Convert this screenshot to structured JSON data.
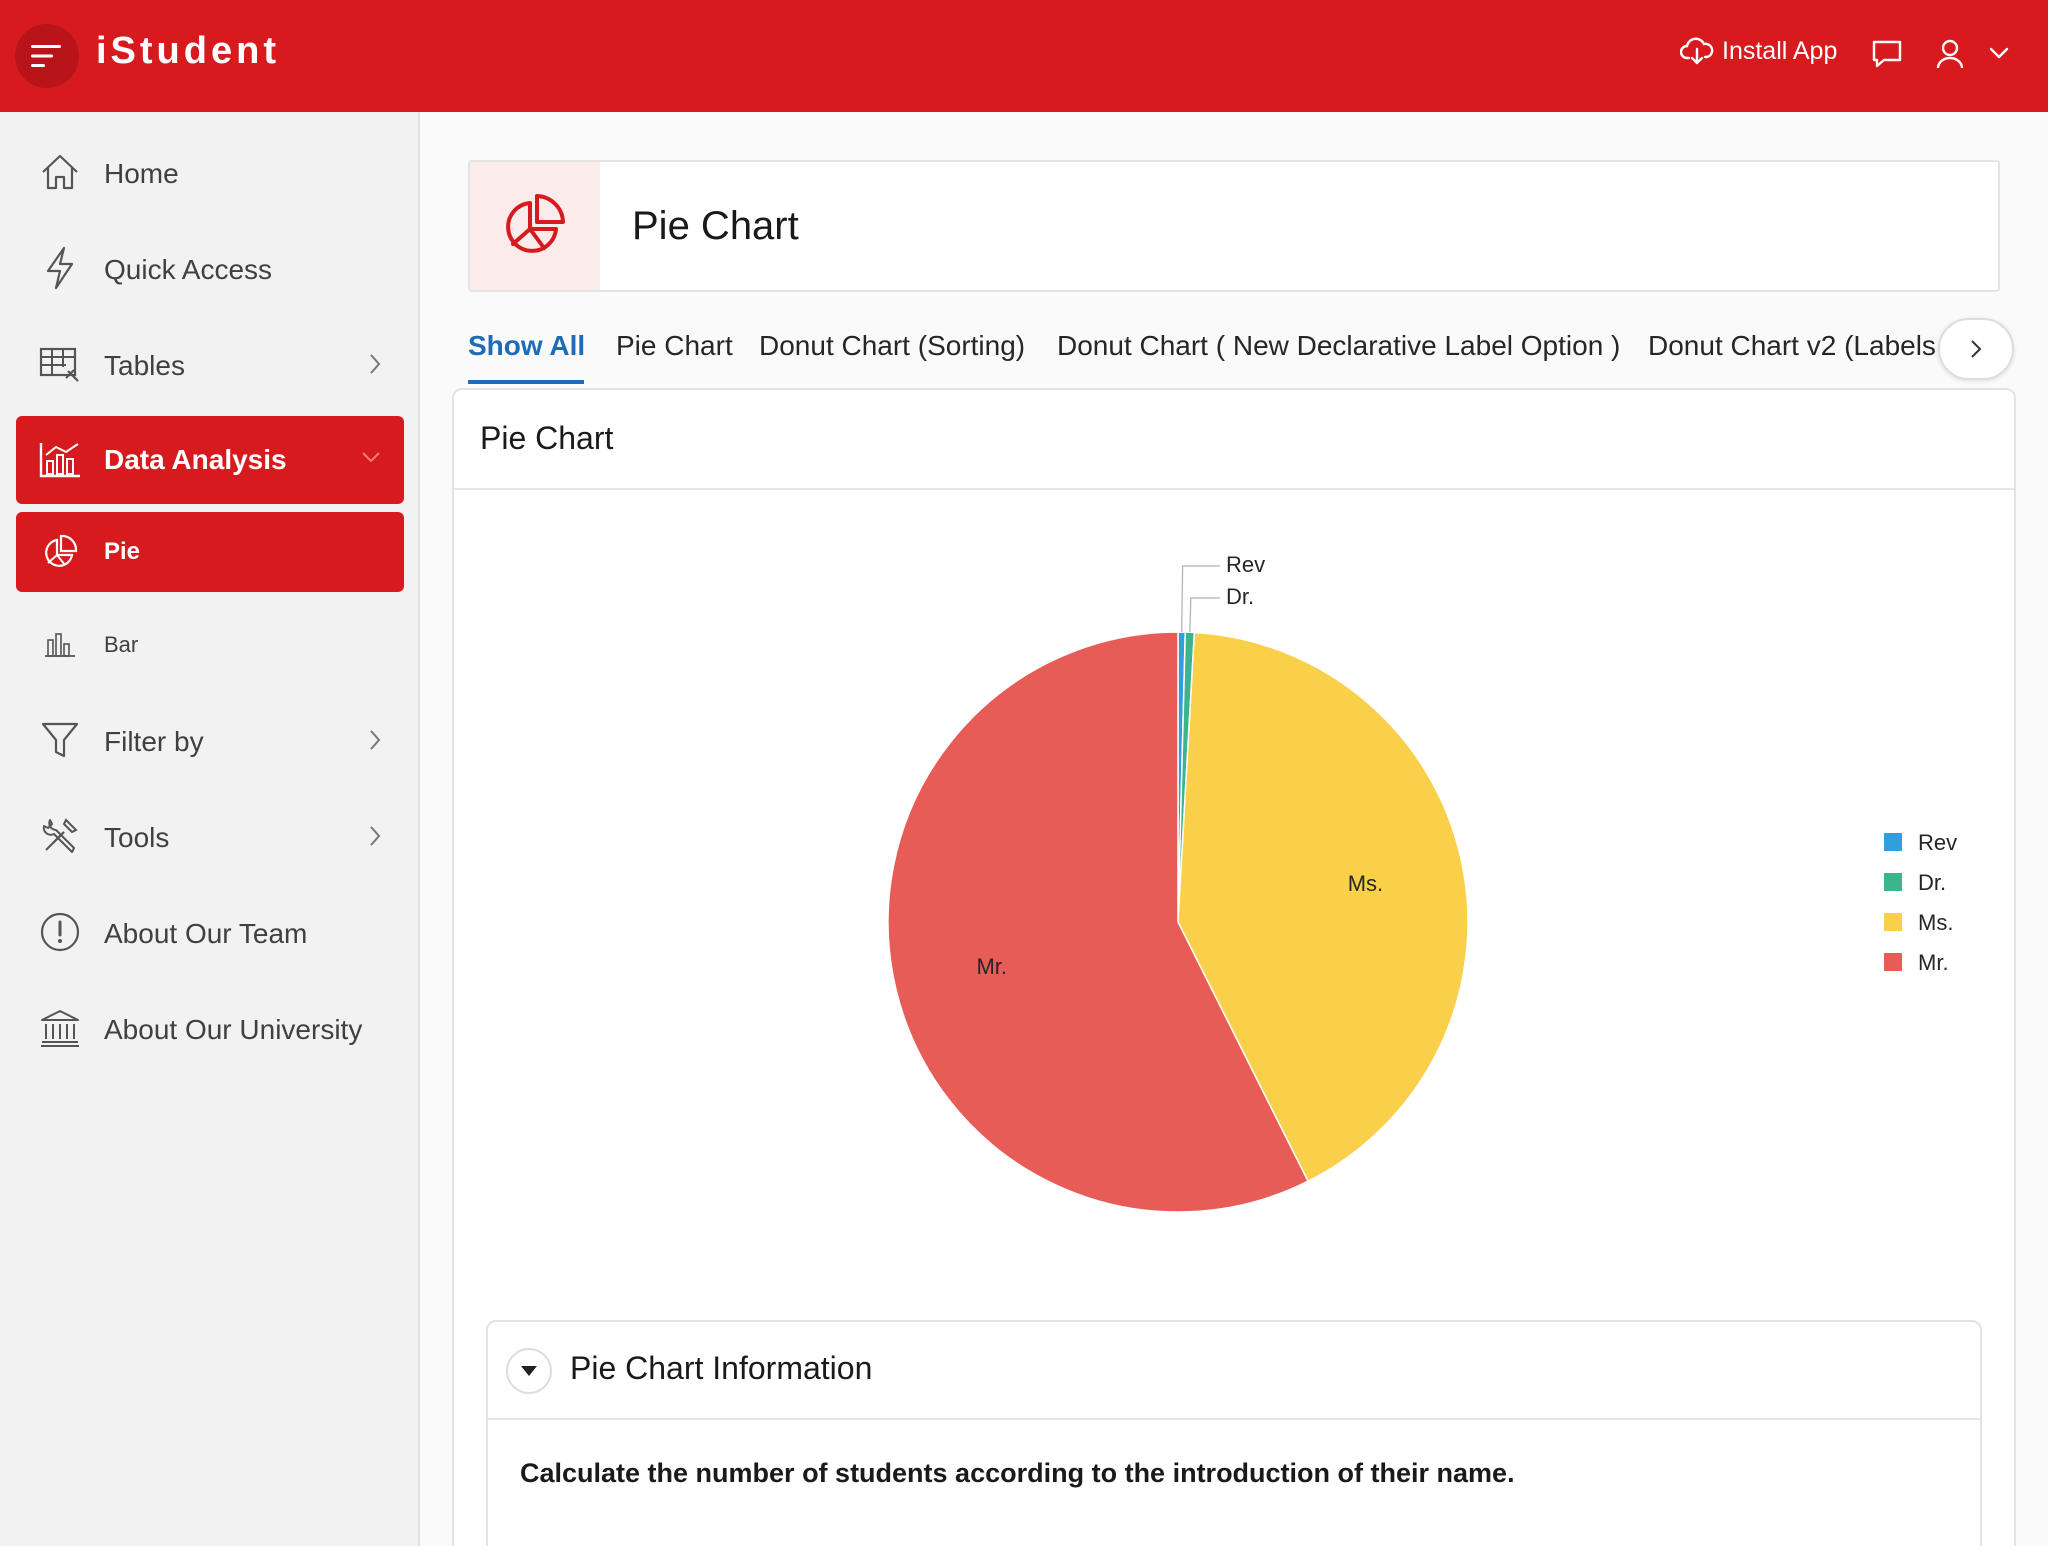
{
  "app": {
    "title": "iStudent"
  },
  "header": {
    "install_label": "Install App"
  },
  "sidebar": {
    "items": [
      {
        "label": "Home"
      },
      {
        "label": "Quick Access"
      },
      {
        "label": "Tables"
      },
      {
        "label": "Data Analysis"
      },
      {
        "label": "Pie"
      },
      {
        "label": "Bar"
      },
      {
        "label": "Filter by"
      },
      {
        "label": "Tools"
      },
      {
        "label": "About Our Team"
      },
      {
        "label": "About Our University"
      }
    ]
  },
  "page": {
    "title": "Pie Chart"
  },
  "tabs": [
    {
      "label": "Show All"
    },
    {
      "label": "Pie Chart"
    },
    {
      "label": "Donut Chart (Sorting)"
    },
    {
      "label": "Donut Chart ( New Declarative Label Option )"
    },
    {
      "label": "Donut Chart v2 (Labels"
    }
  ],
  "region": {
    "title": "Pie Chart"
  },
  "chart_data": {
    "type": "pie",
    "categories": [
      "Rev",
      "Dr.",
      "Ms.",
      "Mr."
    ],
    "values": [
      0.4,
      0.5,
      41.7,
      57.4
    ],
    "colors": [
      "#309fdb",
      "#3cb58c",
      "#fad04a",
      "#e85c57"
    ],
    "labels_outside": [
      "Rev",
      "Dr."
    ],
    "labels_inside": [
      "Ms.",
      "Mr."
    ],
    "legend": {
      "position": "right",
      "entries": [
        "Rev",
        "Dr.",
        "Ms.",
        "Mr."
      ]
    }
  },
  "info": {
    "title": "Pie Chart Information",
    "text": "Calculate the number of students according to the introduction of their name."
  }
}
